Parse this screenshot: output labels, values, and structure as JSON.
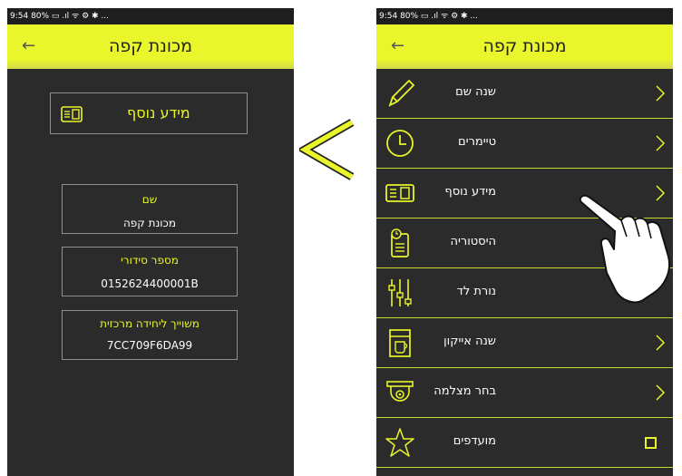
{
  "status": {
    "text": "9:54 80% ▭ .ıl ᯤ ⚙ ✱ ..."
  },
  "left": {
    "title": "מכונת קפה",
    "button_label": "מידע נוסף",
    "fields": [
      {
        "label": "שם",
        "value": "מכונת קפה"
      },
      {
        "label": "מספר סידורי",
        "value": "0152624400001B"
      },
      {
        "label": "משוייך ליחידה מרכזית",
        "value": "7CC709F6DA99"
      }
    ]
  },
  "right": {
    "title": "מכונת קפה",
    "menu": [
      {
        "label": "שנה שם",
        "icon": "pencil-icon",
        "chevron": true
      },
      {
        "label": "טיימרים",
        "icon": "clock-icon",
        "chevron": true
      },
      {
        "label": "מידע נוסף",
        "icon": "id-card-icon",
        "chevron": true
      },
      {
        "label": "היסטוריה",
        "icon": "history-icon",
        "chevron": false
      },
      {
        "label": "נורת לד",
        "icon": "led-sliders-icon",
        "chevron": false
      },
      {
        "label": "שנה אייקון",
        "icon": "coffee-machine-icon",
        "chevron": true
      },
      {
        "label": "בחר מצלמה",
        "icon": "camera-icon",
        "chevron": true
      },
      {
        "label": "מועדפים",
        "icon": "star-icon",
        "chevron": false,
        "checkbox": true
      }
    ]
  },
  "colors": {
    "accent": "#e8f52a",
    "background": "#2b2b2b",
    "arrow": "#e8f52a"
  }
}
